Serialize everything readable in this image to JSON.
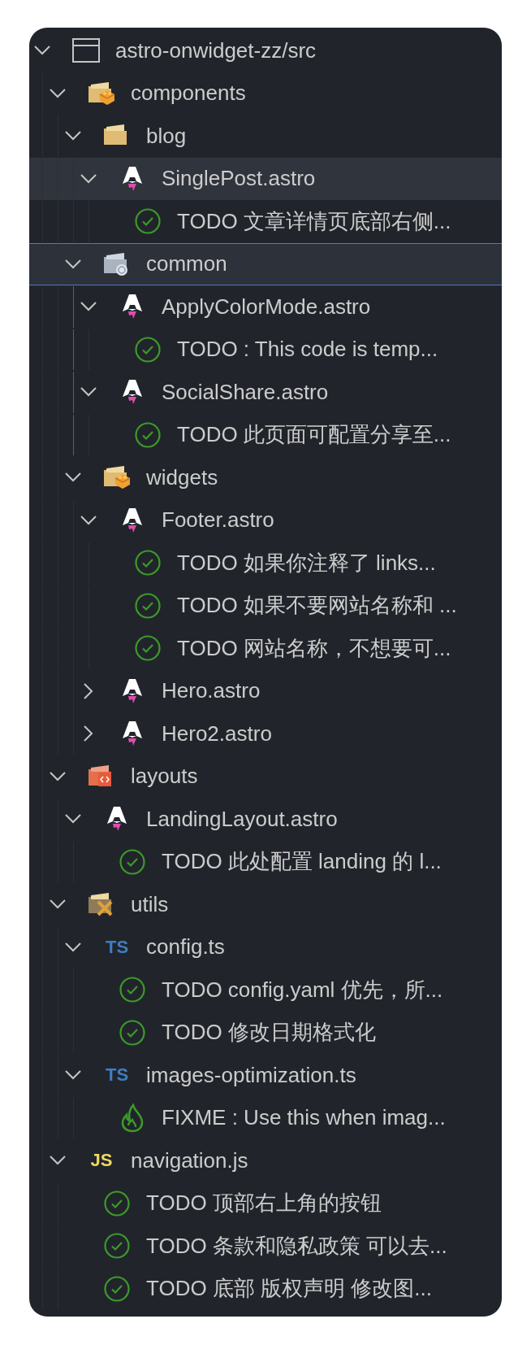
{
  "tree": {
    "kind": "workspace",
    "label": "astro-onwidget-zz/src",
    "expanded": true,
    "selected": false,
    "hovered": false,
    "children": [
      {
        "kind": "blocks",
        "label": "components",
        "expanded": true,
        "selected": false,
        "hovered": false,
        "children": [
          {
            "kind": "folder",
            "label": "blog",
            "expanded": true,
            "selected": false,
            "hovered": false,
            "children": [
              {
                "kind": "astro",
                "label": "SinglePost.astro",
                "expanded": true,
                "selected": false,
                "hovered": true,
                "children": [
                  {
                    "kind": "todo",
                    "label": "TODO 文章详情页底部右侧...",
                    "selected": false,
                    "hovered": false
                  }
                ]
              }
            ]
          },
          {
            "kind": "common",
            "label": "common",
            "expanded": true,
            "selected": true,
            "hovered": false,
            "children": [
              {
                "kind": "astro",
                "label": "ApplyColorMode.astro",
                "expanded": true,
                "selected": false,
                "hovered": false,
                "children": [
                  {
                    "kind": "todo",
                    "label": "TODO : This code is temp...",
                    "selected": false,
                    "hovered": false
                  }
                ]
              },
              {
                "kind": "astro",
                "label": "SocialShare.astro",
                "expanded": true,
                "selected": false,
                "hovered": false,
                "children": [
                  {
                    "kind": "todo",
                    "label": "TODO 此页面可配置分享至...",
                    "selected": false,
                    "hovered": false
                  }
                ]
              }
            ]
          },
          {
            "kind": "blocks",
            "label": "widgets",
            "expanded": true,
            "selected": false,
            "hovered": false,
            "children": [
              {
                "kind": "astro",
                "label": "Footer.astro",
                "expanded": true,
                "selected": false,
                "hovered": false,
                "children": [
                  {
                    "kind": "todo",
                    "label": "TODO 如果你注释了 links...",
                    "selected": false,
                    "hovered": false
                  },
                  {
                    "kind": "todo",
                    "label": "TODO 如果不要网站名称和 ...",
                    "selected": false,
                    "hovered": false
                  },
                  {
                    "kind": "todo",
                    "label": "TODO 网站名称，不想要可...",
                    "selected": false,
                    "hovered": false
                  }
                ]
              },
              {
                "kind": "astro",
                "label": "Hero.astro",
                "expanded": false,
                "selected": false,
                "hovered": false
              },
              {
                "kind": "astro",
                "label": "Hero2.astro",
                "expanded": false,
                "selected": false,
                "hovered": false
              }
            ]
          }
        ]
      },
      {
        "kind": "layout",
        "label": "layouts",
        "expanded": true,
        "selected": false,
        "hovered": false,
        "children": [
          {
            "kind": "astro",
            "label": "LandingLayout.astro",
            "expanded": true,
            "selected": false,
            "hovered": false,
            "children": [
              {
                "kind": "todo",
                "label": "TODO 此处配置 landing 的 l...",
                "selected": false,
                "hovered": false
              }
            ]
          }
        ]
      },
      {
        "kind": "tools",
        "label": "utils",
        "expanded": true,
        "selected": false,
        "hovered": false,
        "children": [
          {
            "kind": "ts",
            "badge": "TS",
            "label": "config.ts",
            "expanded": true,
            "selected": false,
            "hovered": false,
            "children": [
              {
                "kind": "todo",
                "label": "TODO config.yaml 优先，所...",
                "selected": false,
                "hovered": false
              },
              {
                "kind": "todo",
                "label": "TODO 修改日期格式化",
                "selected": false,
                "hovered": false
              }
            ]
          },
          {
            "kind": "ts",
            "badge": "TS",
            "label": "images-optimization.ts",
            "expanded": true,
            "selected": false,
            "hovered": false,
            "children": [
              {
                "kind": "fixme",
                "label": "FIXME : Use this when imag...",
                "selected": false,
                "hovered": false
              }
            ]
          }
        ]
      },
      {
        "kind": "js",
        "badge": "JS",
        "label": "navigation.js",
        "expanded": true,
        "selected": false,
        "hovered": false,
        "children": [
          {
            "kind": "todo",
            "label": "TODO 顶部右上角的按钮",
            "selected": false,
            "hovered": false
          },
          {
            "kind": "todo",
            "label": "TODO 条款和隐私政策 可以去...",
            "selected": false,
            "hovered": false
          },
          {
            "kind": "todo",
            "label": "TODO 底部 版权声明 修改图...",
            "selected": false,
            "hovered": false
          }
        ]
      }
    ]
  }
}
